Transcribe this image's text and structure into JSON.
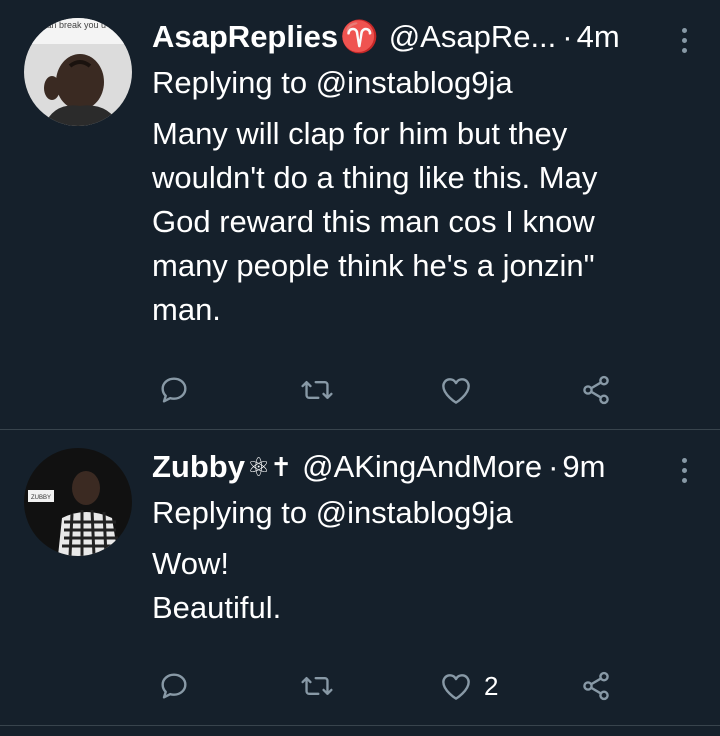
{
  "tweets": [
    {
      "name": "AsapReplies",
      "name_emoji": "♈",
      "handle": "@AsapRe...",
      "separator": "·",
      "time": "4m",
      "replying": "Replying to @instablog9ja",
      "body_lines": [
        "Many will clap for him but they",
        "wouldn't do a thing like this. May",
        "God reward this man cos I know",
        "many people think he's a jonzin\"",
        "man."
      ],
      "avatar_caption": "can break you u are single",
      "like_count": ""
    },
    {
      "name": "Zubby",
      "name_emoji": "⚛✝",
      "handle": "@AKingAndMore",
      "separator": "·",
      "time": "9m",
      "replying": "Replying to @instablog9ja",
      "body_lines": [
        "Wow!",
        "Beautiful."
      ],
      "avatar_caption": "ZUBBY",
      "like_count": "2"
    }
  ],
  "icons": {
    "reply": "reply-icon",
    "retweet": "retweet-icon",
    "like": "heart-icon",
    "share": "share-icon",
    "more": "more-vertical-icon"
  },
  "colors": {
    "background": "#15202b",
    "icon": "#8899a6",
    "divider": "#38444d"
  }
}
